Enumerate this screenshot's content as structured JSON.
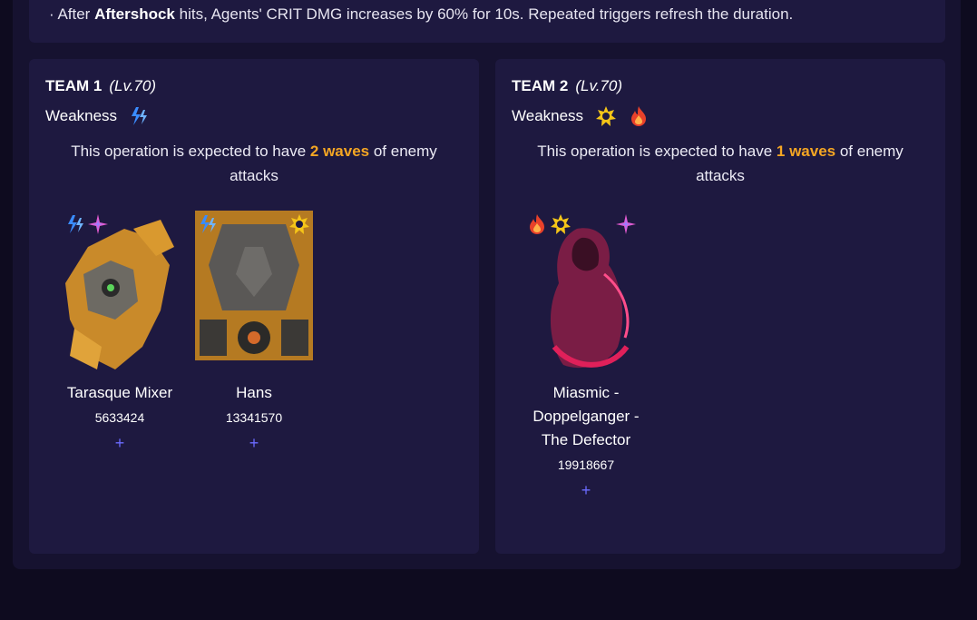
{
  "buff": {
    "prefix": "· After ",
    "keyword": "Aftershock",
    "suffix": " hits, Agents' CRIT DMG increases by 60% for 10s. Repeated triggers refresh the duration."
  },
  "teams": [
    {
      "name": "TEAM 1",
      "level": "(Lv.70)",
      "weakness_label": "Weakness",
      "weakness_icons": [
        "electric-icon"
      ],
      "waves_prefix": "This operation is expected to have ",
      "waves_count": "2 waves",
      "waves_suffix": " of enemy attacks",
      "enemies": [
        {
          "name": "Tarasque Mixer",
          "hp": "5633424",
          "plus": "+",
          "badges": [
            "electric-icon",
            "ether-icon"
          ]
        },
        {
          "name": "Hans",
          "hp": "13341570",
          "plus": "+",
          "badges": [
            "electric-icon",
            "physical-icon"
          ]
        }
      ]
    },
    {
      "name": "TEAM 2",
      "level": "(Lv.70)",
      "weakness_label": "Weakness",
      "weakness_icons": [
        "physical-icon",
        "fire-icon"
      ],
      "waves_prefix": "This operation is expected to have ",
      "waves_count": "1 waves",
      "waves_suffix": " of enemy attacks",
      "enemies": [
        {
          "name": "Miasmic - Doppelganger - The Defector",
          "hp": "19918667",
          "plus": "+",
          "badges": [
            "fire-icon",
            "physical-icon",
            "ether-icon"
          ]
        }
      ]
    }
  ],
  "colors": {
    "accent": "#f5a623",
    "plus": "#6b6bff",
    "panel": "#1e1940",
    "background": "#0e0b1f"
  }
}
